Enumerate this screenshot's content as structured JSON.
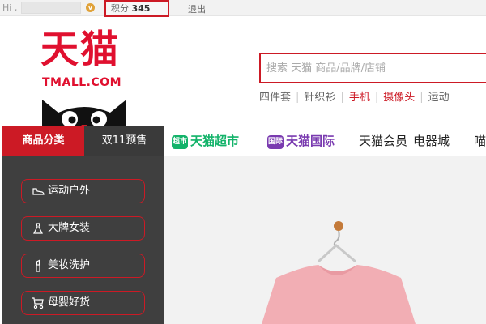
{
  "topbar": {
    "greeting": "Hi ,",
    "points_label": "积分",
    "points_value": "345",
    "logout": "退出"
  },
  "logo": {
    "cn": "天猫",
    "en": "TMALL.COM"
  },
  "search": {
    "placeholder": "搜索 天猫 商品/品牌/店铺"
  },
  "hotwords": [
    {
      "text": "四件套"
    },
    {
      "text": "针织衫"
    },
    {
      "text": "手机"
    },
    {
      "text": "摄像头"
    },
    {
      "text": "运动"
    }
  ],
  "nav": {
    "category": "商品分类",
    "double11": "双11预售",
    "supermarket_badge": "超市",
    "supermarket": "天猫超市",
    "intl_badge": "国际",
    "intl": "天猫国际",
    "member": "天猫会员",
    "appliance": "电器城",
    "more": "喵"
  },
  "sidebar": {
    "items": [
      {
        "label": "运动户外",
        "icon": "shoe-icon"
      },
      {
        "label": "大牌女装",
        "icon": "dress-icon"
      },
      {
        "label": "美妆洗护",
        "icon": "lipstick-icon"
      },
      {
        "label": "母婴好货",
        "icon": "stroller-icon"
      }
    ]
  },
  "colors": {
    "brand_red": "#cc1a25",
    "logo_red": "#e0102f",
    "supermarket_green": "#13b36a",
    "intl_purple": "#7a3bb0",
    "sidebar_bg": "#3f3f3f",
    "sweater_pink": "#f2aeb4"
  }
}
